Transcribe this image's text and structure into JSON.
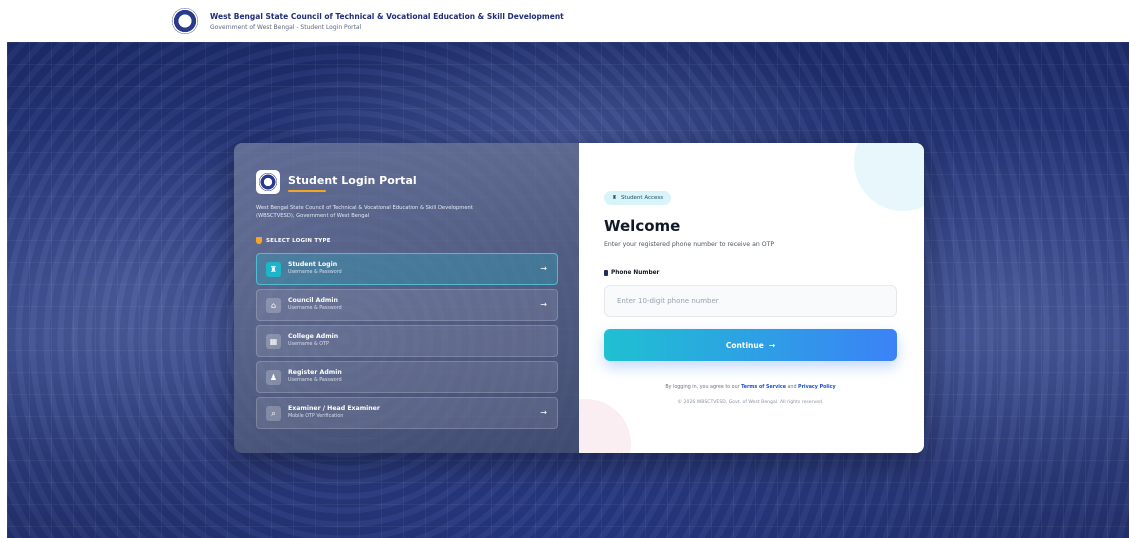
{
  "header": {
    "title": "West Bengal State Council of Technical & Vocational Education & Skill Development",
    "subtitle": "Government of West Bengal - Student Login Portal"
  },
  "left_panel": {
    "title": "Student Login Portal",
    "description": "West Bengal State Council of Technical & Vocational Education & Skill Development (WBSCTVESD), Government of West Bengal",
    "section_label": "SELECT LOGIN TYPE",
    "options": [
      {
        "title": "Student Login",
        "subtitle": "Username & Password",
        "icon": "student-cap-icon",
        "glyph": "♜",
        "arrow": "→",
        "active": true
      },
      {
        "title": "Council Admin",
        "subtitle": "Username & Password",
        "icon": "building-icon",
        "glyph": "⌂",
        "arrow": "→",
        "active": false
      },
      {
        "title": "College Admin",
        "subtitle": "Username & OTP",
        "icon": "college-icon",
        "glyph": "▦",
        "arrow": "",
        "active": false
      },
      {
        "title": "Register Admin",
        "subtitle": "Username & Password",
        "icon": "user-icon",
        "glyph": "♟",
        "arrow": "",
        "active": false
      },
      {
        "title": "Examiner / Head Examiner",
        "subtitle": "Mobile OTP Verification",
        "icon": "examiner-icon",
        "glyph": "⌕",
        "arrow": "→",
        "active": false
      }
    ]
  },
  "right_panel": {
    "badge": "Student Access",
    "heading": "Welcome",
    "subtitle": "Enter your registered phone number to receive an OTP",
    "phone_label": "Phone Number",
    "phone_placeholder": "Enter 10-digit phone number",
    "phone_value": "",
    "continue_label": "Continue",
    "continue_arrow": "→",
    "terms_prefix": "By logging in, you agree to our",
    "terms_link": "Terms of Service",
    "terms_and": "and",
    "privacy_link": "Privacy Policy",
    "copyright": "© 2026 WBSCTVESD, Govt. of West Bengal. All rights reserved."
  },
  "colors": {
    "accent": "#1fb5c8",
    "button_gradient_start": "#1fc0d2",
    "button_gradient_end": "#3b82f6",
    "brand_navy": "#1f2d7a",
    "underline_orange": "#f5a524",
    "link_blue": "#1d4ed8"
  }
}
